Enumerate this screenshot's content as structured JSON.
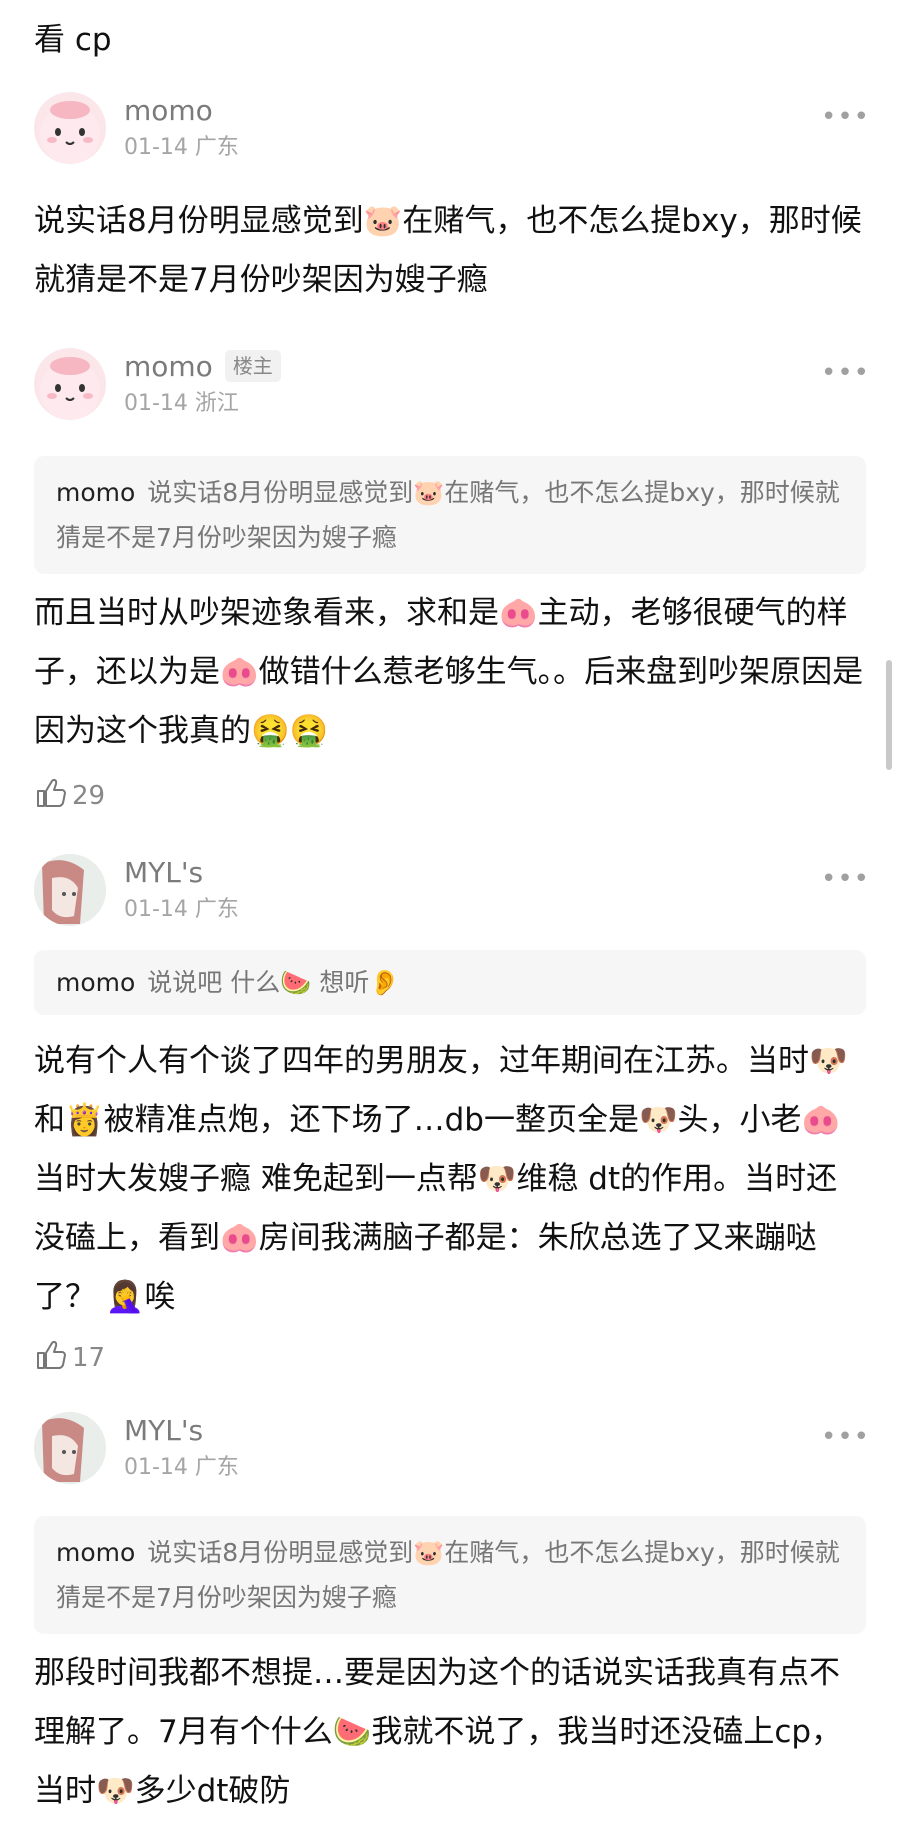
{
  "top_fragment": "看 cp",
  "comments": [
    {
      "user": "momo",
      "meta": "01-14 广东",
      "badge": "",
      "quote_user": "",
      "quote_text": "",
      "body": "说实话8月份明显感觉到🐷在赌气，也不怎么提bxy，那时候就猜是不是7月份吵架因为嫂子瘾",
      "likes": ""
    },
    {
      "user": "momo",
      "badge": "楼主",
      "meta": "01-14 浙江",
      "quote_user": "momo",
      "quote_text": "说实话8月份明显感觉到🐷在赌气，也不怎么提bxy，那时候就猜是不是7月份吵架因为嫂子瘾",
      "body": "而且当时从吵架迹象看来，求和是🐽主动，老够很硬气的样子，还以为是🐽做错什么惹老够生气。。后来盘到吵架原因是因为这个我真的🤮🤮",
      "likes": "29"
    },
    {
      "user": "MYL's",
      "badge": "",
      "meta": "01-14 广东",
      "quote_user": "momo",
      "quote_text": "说说吧 什么🍉 想听👂",
      "body": "说有个人有个谈了四年的男朋友，过年期间在江苏。当时🐶和👸被精准点炮，还下场了…db一整页全是🐶头，小老🐽当时大发嫂子瘾 难免起到一点帮🐶维稳 dt的作用。当时还没磕上，看到🐽房间我满脑子都是：朱欣总选了又来蹦哒了？ 🤦‍♀️唉",
      "likes": "17"
    },
    {
      "user": "MYL's",
      "badge": "",
      "meta": "01-14 广东",
      "quote_user": "momo",
      "quote_text": "说实话8月份明显感觉到🐷在赌气，也不怎么提bxy，那时候就猜是不是7月份吵架因为嫂子瘾",
      "body": "那段时间我都不想提…要是因为这个的话说实话我真有点不理解了。7月有个什么🍉我就不说了，我当时还没磕上cp，当时🐶多少dt破防",
      "likes": ""
    }
  ],
  "icons": {
    "more": "more-dots-icon",
    "like": "thumbs-up-icon"
  },
  "colors": {
    "username": "#7b7b7b",
    "meta": "#a5a5a5",
    "quote_bg": "#f6f6f6",
    "body": "#111111"
  }
}
